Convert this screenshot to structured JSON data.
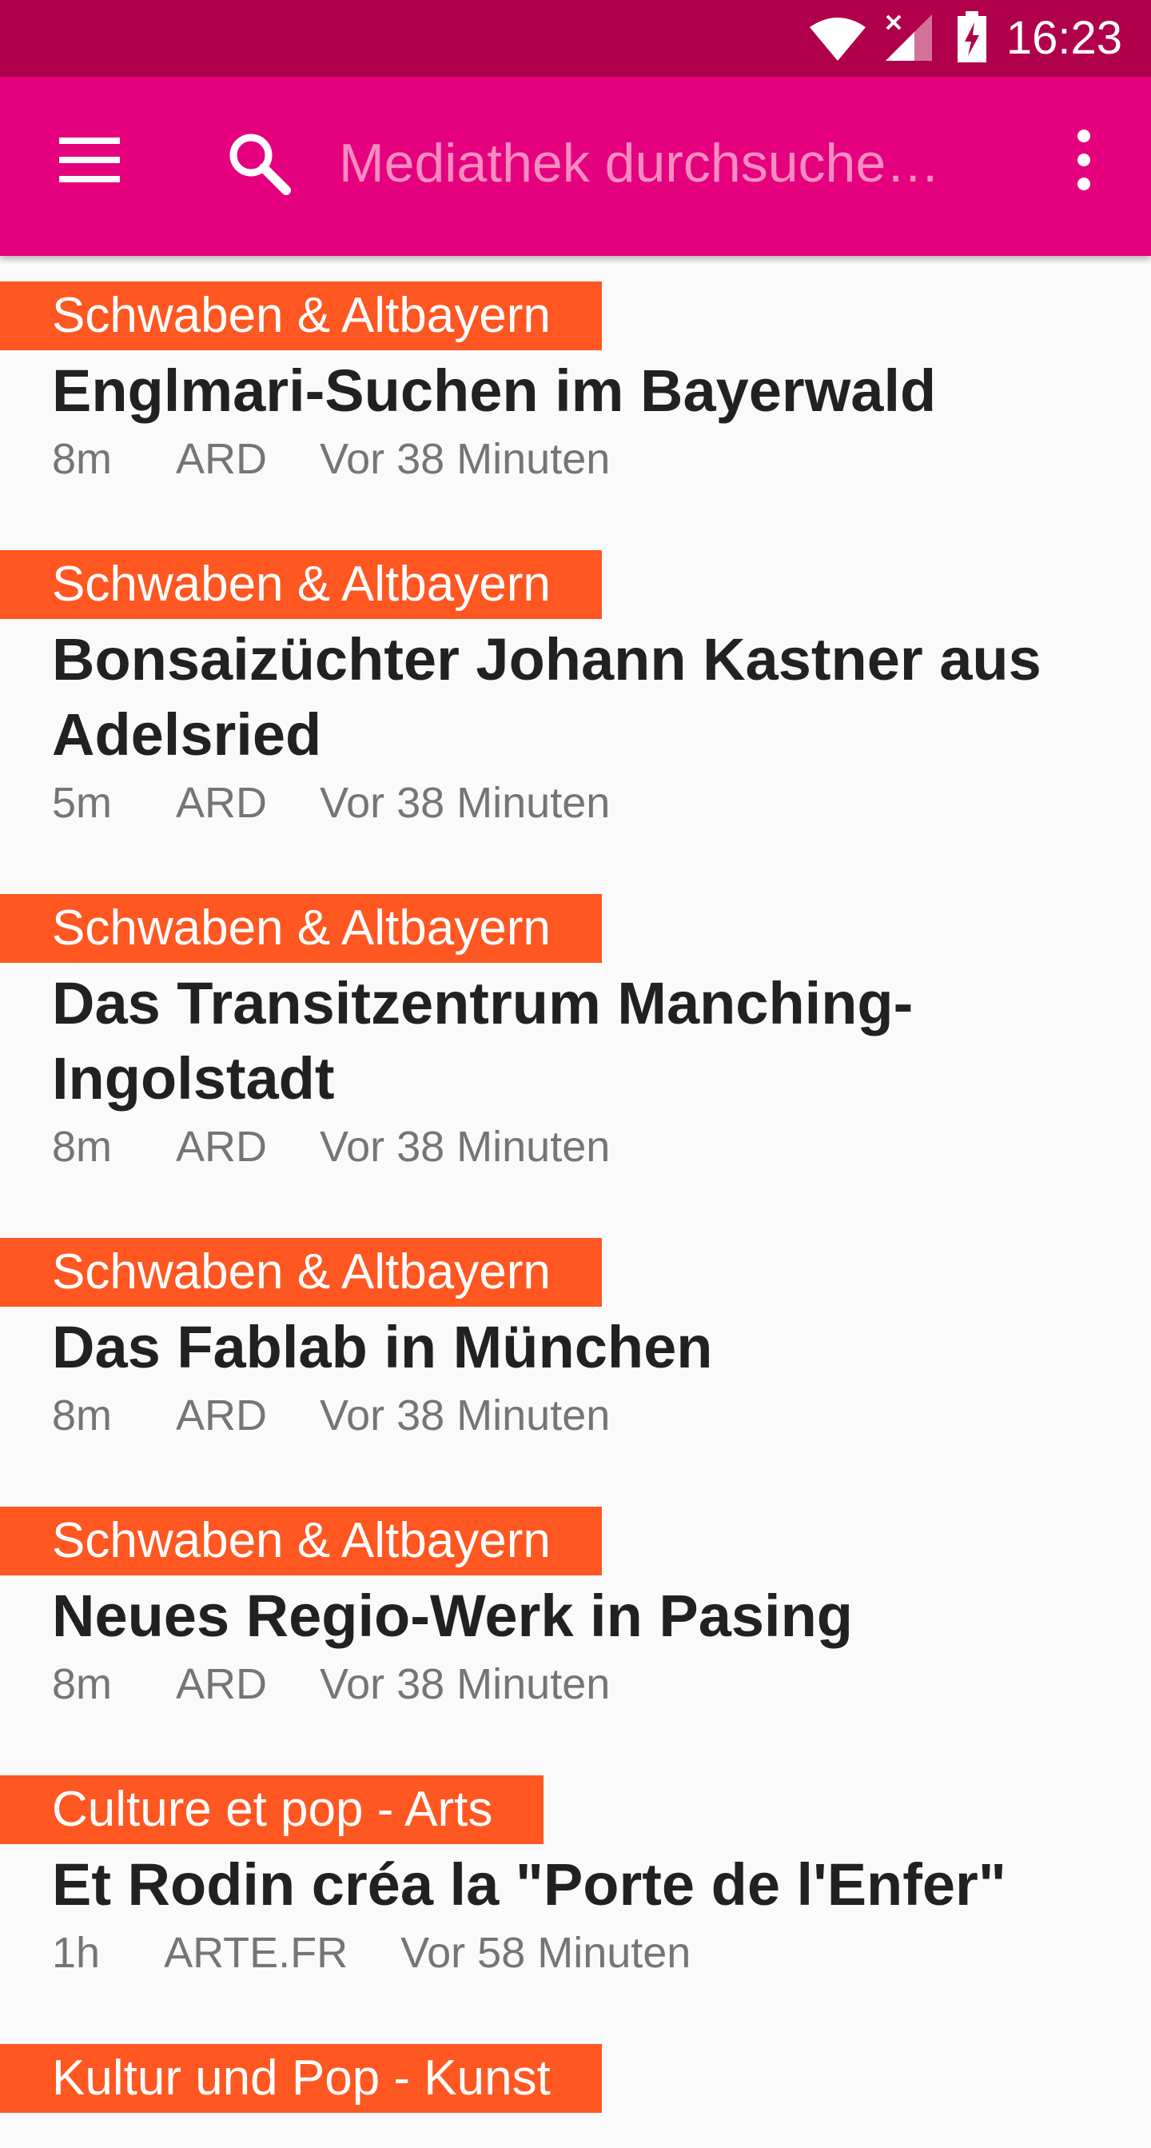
{
  "status_bar": {
    "time": "16:23",
    "icons": [
      "wifi-icon",
      "signal-icon",
      "battery-charging-icon"
    ]
  },
  "app_bar": {
    "search_placeholder": "Mediathek durchsuche…",
    "colors": {
      "app_bar": "#E5007E",
      "status_bar": "#B0004B",
      "category_tag": "#FF5722"
    }
  },
  "feed": {
    "items": [
      {
        "category": "Schwaben & Altbayern",
        "title": "Englmari-Suchen im Bayerwald",
        "duration": "8m",
        "channel": "ARD",
        "age": "Vor 38 Minuten"
      },
      {
        "category": "Schwaben & Altbayern",
        "title": "Bonsaizüchter Johann Kastner aus Adelsried",
        "duration": "5m",
        "channel": "ARD",
        "age": "Vor 38 Minuten"
      },
      {
        "category": "Schwaben & Altbayern",
        "title": "Das Transitzentrum Manching-Ingolstadt",
        "duration": "8m",
        "channel": "ARD",
        "age": "Vor 38 Minuten"
      },
      {
        "category": "Schwaben & Altbayern",
        "title": "Das Fablab in München",
        "duration": "8m",
        "channel": "ARD",
        "age": "Vor 38 Minuten"
      },
      {
        "category": "Schwaben & Altbayern",
        "title": "Neues Regio-Werk in Pasing",
        "duration": "8m",
        "channel": "ARD",
        "age": "Vor 38 Minuten"
      },
      {
        "category": "Culture et pop - Arts",
        "title": "Et Rodin créa la \"Porte de l'Enfer\"",
        "duration": "1h",
        "channel": "ARTE.FR",
        "age": "Vor 58 Minuten"
      },
      {
        "category": "Kultur und Pop - Kunst",
        "title": "",
        "duration": "",
        "channel": "",
        "age": ""
      }
    ]
  }
}
